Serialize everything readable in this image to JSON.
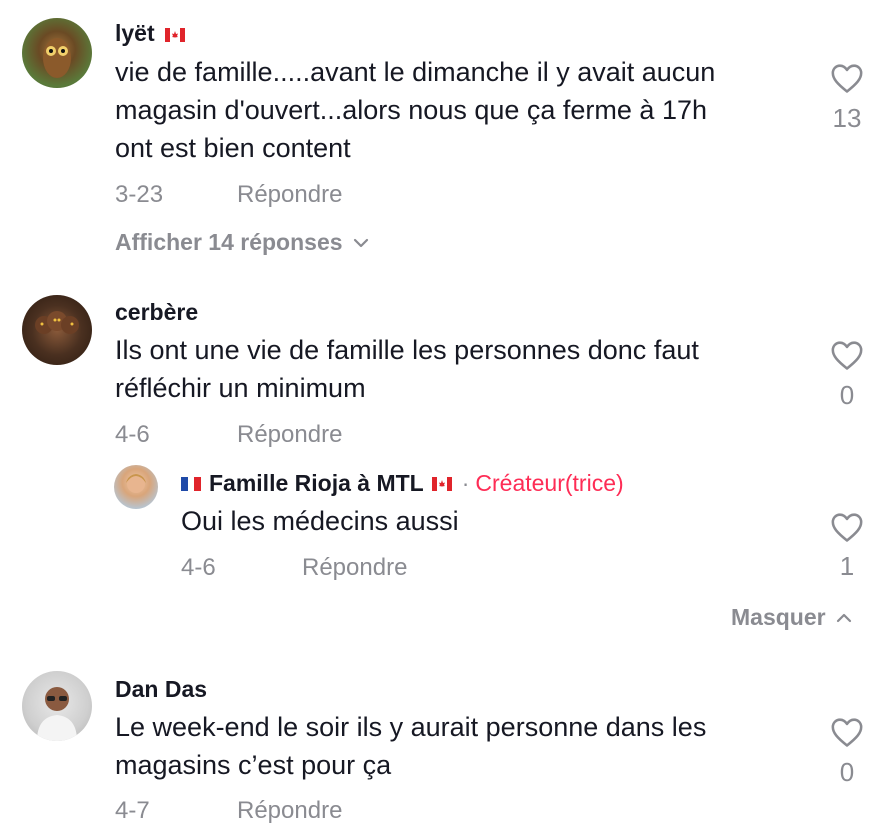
{
  "comments": [
    {
      "username": "lyët",
      "text_lines": [
        "vie de famille.....avant le dimanche il y avait aucun",
        "magasin d'ouvert...alors nous que ça ferme à 17h",
        "ont est bien content"
      ],
      "date": "3-23",
      "reply_label": "Répondre",
      "likes": "13",
      "view_replies": "Afficher 14 réponses"
    },
    {
      "username": "cerbère",
      "text_lines": [
        "Ils ont une vie de famille les personnes donc faut",
        "réfléchir un minimum"
      ],
      "date": "4-6",
      "reply_label": "Répondre",
      "likes": "0",
      "reply": {
        "username": "Famille Rioja à MTL",
        "separator": "·",
        "creator_label": "Créateur(trice)",
        "text": "Oui les médecins aussi",
        "date": "4-6",
        "reply_label": "Répondre",
        "likes": "1"
      },
      "hide_label": "Masquer"
    },
    {
      "username": "Dan Das",
      "text_lines": [
        "Le week-end le soir ils y aurait personne dans les",
        "magasins c’est pour ça"
      ],
      "date": "4-7",
      "reply_label": "Répondre",
      "likes": "0"
    }
  ],
  "colors": {
    "text": "#161823",
    "muted": "#8a8b91",
    "creator": "#fe2c55"
  }
}
